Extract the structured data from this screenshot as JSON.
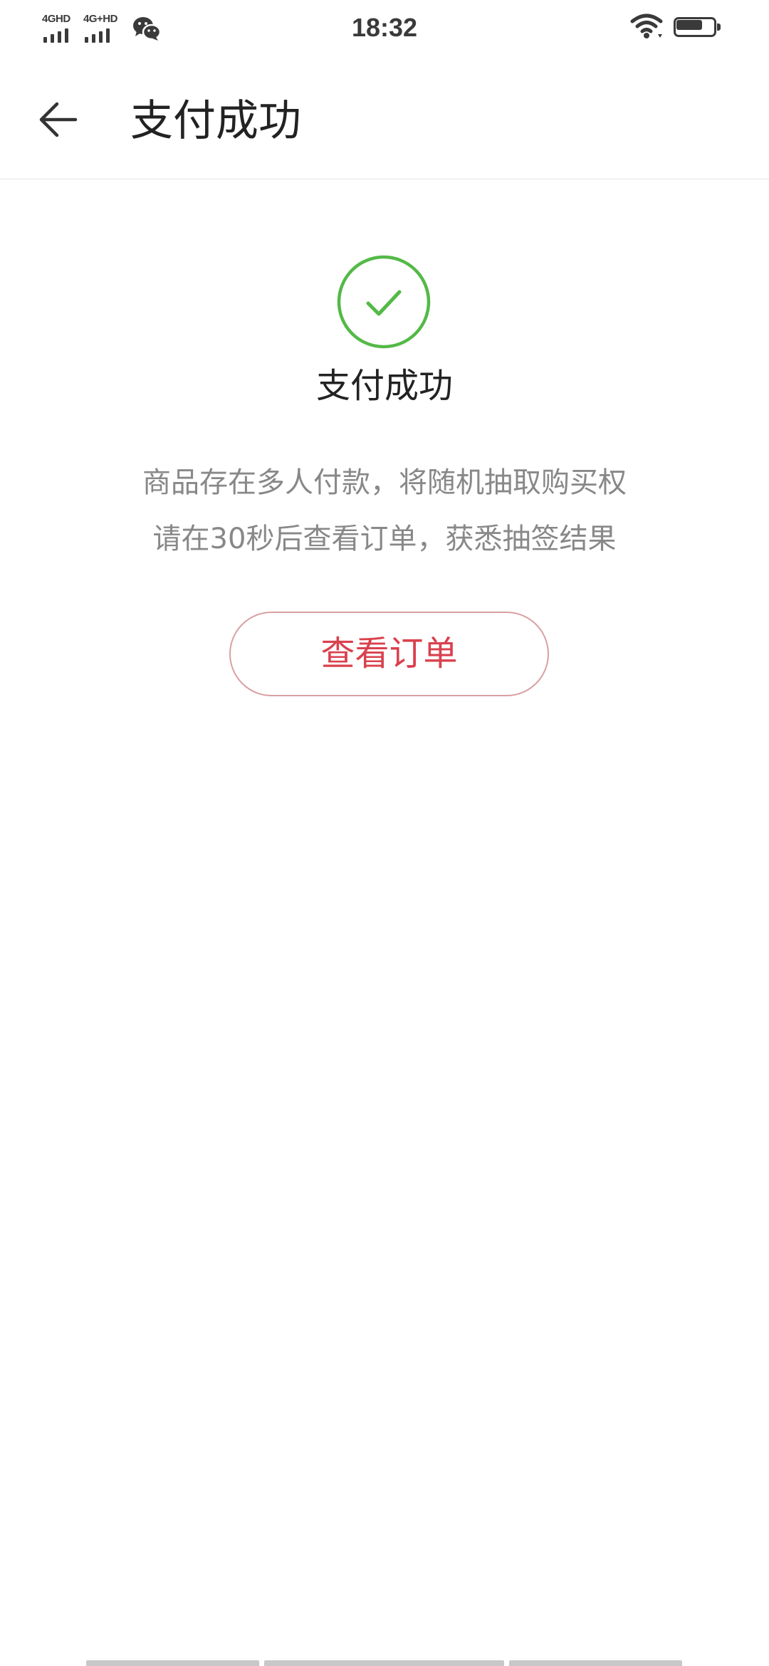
{
  "status_bar": {
    "network_1": "4GHD",
    "network_2": "4G+HD",
    "app_icon": "wechat-icon",
    "time": "18:32",
    "wifi_icon": "wifi-icon",
    "battery_icon": "battery-icon",
    "battery_level": 0.78
  },
  "header": {
    "back_icon": "arrow-left-icon",
    "title": "支付成功"
  },
  "main": {
    "status_icon": "check-circle-icon",
    "status_title": "支付成功",
    "message_lines": [
      "商品存在多人付款，将随机抽取购买权",
      "请在30秒后查看订单，获悉抽签结果"
    ],
    "view_order_label": "查看订单"
  },
  "colors": {
    "success_green": "#54b947",
    "accent_red": "#d9414d",
    "button_border": "#d9a0a3",
    "secondary_text": "#888888"
  }
}
